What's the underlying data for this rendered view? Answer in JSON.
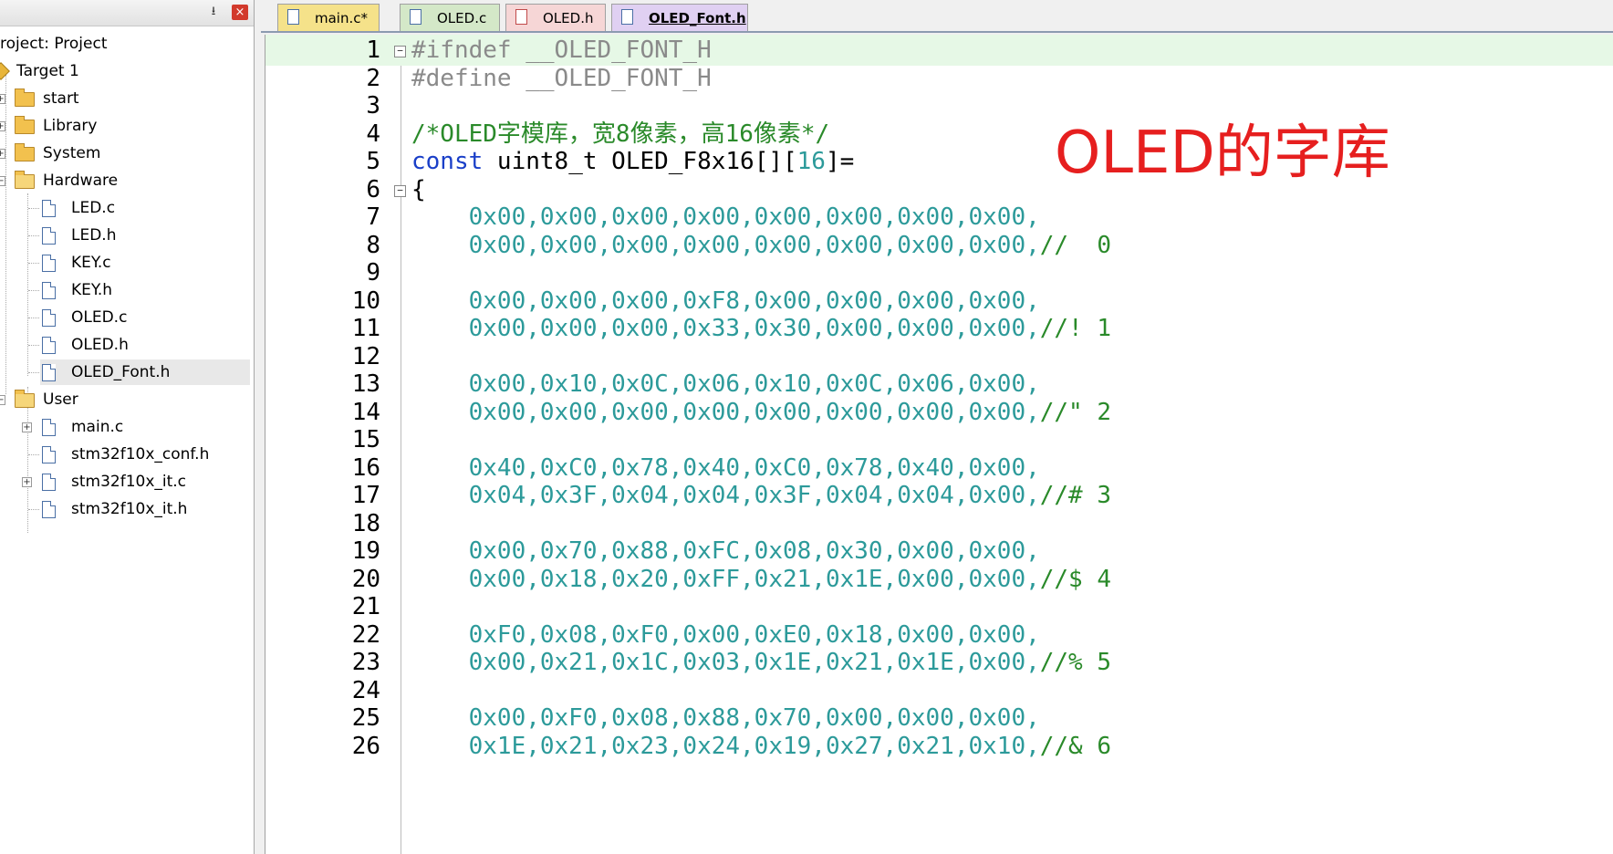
{
  "panel": {
    "pin": " ↓",
    "close": "×",
    "tree": [
      {
        "label": "roject: Project"
      },
      {
        "label": "Target 1"
      },
      {
        "label": "start"
      },
      {
        "label": "Library"
      },
      {
        "label": "System"
      },
      {
        "label": "Hardware"
      },
      {
        "label": "LED.c"
      },
      {
        "label": "LED.h"
      },
      {
        "label": "KEY.c"
      },
      {
        "label": "KEY.h"
      },
      {
        "label": "OLED.c"
      },
      {
        "label": "OLED.h"
      },
      {
        "label": "OLED_Font.h"
      },
      {
        "label": "User"
      },
      {
        "label": "main.c"
      },
      {
        "label": "stm32f10x_conf.h"
      },
      {
        "label": "stm32f10x_it.c"
      },
      {
        "label": "stm32f10x_it.h"
      }
    ]
  },
  "tabs": [
    {
      "label": "main.c*"
    },
    {
      "label": "OLED.c"
    },
    {
      "label": "OLED.h"
    },
    {
      "label": "OLED_Font.h"
    }
  ],
  "editor": {
    "lines": [
      {
        "n": "1",
        "segments": [
          {
            "t": "#ifndef __OLED_FONT_H",
            "c": "pre"
          }
        ]
      },
      {
        "n": "2",
        "segments": [
          {
            "t": "#define __OLED_FONT_H",
            "c": "pre"
          }
        ]
      },
      {
        "n": "3",
        "segments": []
      },
      {
        "n": "4",
        "segments": [
          {
            "t": "/*OLED字模库，宽8像素，高16像素*/",
            "c": "com"
          }
        ]
      },
      {
        "n": "5",
        "segments": [
          {
            "t": "const",
            "c": "kw"
          },
          {
            "t": " uint8_t OLED_F8x16[][",
            "c": "plain"
          },
          {
            "t": "16",
            "c": "num"
          },
          {
            "t": "]=",
            "c": "plain"
          }
        ]
      },
      {
        "n": "6",
        "segments": [
          {
            "t": "{",
            "c": "plain"
          }
        ]
      },
      {
        "n": "7",
        "segments": [
          {
            "t": "    0x00,0x00,0x00,0x00,0x00,0x00,0x00,0x00,",
            "c": "num"
          }
        ]
      },
      {
        "n": "8",
        "segments": [
          {
            "t": "    0x00,0x00,0x00,0x00,0x00,0x00,0x00,0x00,",
            "c": "num"
          },
          {
            "t": "//  0",
            "c": "com"
          }
        ]
      },
      {
        "n": "9",
        "segments": []
      },
      {
        "n": "10",
        "segments": [
          {
            "t": "    0x00,0x00,0x00,0xF8,0x00,0x00,0x00,0x00,",
            "c": "num"
          }
        ]
      },
      {
        "n": "11",
        "segments": [
          {
            "t": "    0x00,0x00,0x00,0x33,0x30,0x00,0x00,0x00,",
            "c": "num"
          },
          {
            "t": "//! 1",
            "c": "com"
          }
        ]
      },
      {
        "n": "12",
        "segments": []
      },
      {
        "n": "13",
        "segments": [
          {
            "t": "    0x00,0x10,0x0C,0x06,0x10,0x0C,0x06,0x00,",
            "c": "num"
          }
        ]
      },
      {
        "n": "14",
        "segments": [
          {
            "t": "    0x00,0x00,0x00,0x00,0x00,0x00,0x00,0x00,",
            "c": "num"
          },
          {
            "t": "//\" 2",
            "c": "com"
          }
        ]
      },
      {
        "n": "15",
        "segments": []
      },
      {
        "n": "16",
        "segments": [
          {
            "t": "    0x40,0xC0,0x78,0x40,0xC0,0x78,0x40,0x00,",
            "c": "num"
          }
        ]
      },
      {
        "n": "17",
        "segments": [
          {
            "t": "    0x04,0x3F,0x04,0x04,0x3F,0x04,0x04,0x00,",
            "c": "num"
          },
          {
            "t": "//# 3",
            "c": "com"
          }
        ]
      },
      {
        "n": "18",
        "segments": []
      },
      {
        "n": "19",
        "segments": [
          {
            "t": "    0x00,0x70,0x88,0xFC,0x08,0x30,0x00,0x00,",
            "c": "num"
          }
        ]
      },
      {
        "n": "20",
        "segments": [
          {
            "t": "    0x00,0x18,0x20,0xFF,0x21,0x1E,0x00,0x00,",
            "c": "num"
          },
          {
            "t": "//$ 4",
            "c": "com"
          }
        ]
      },
      {
        "n": "21",
        "segments": []
      },
      {
        "n": "22",
        "segments": [
          {
            "t": "    0xF0,0x08,0xF0,0x00,0xE0,0x18,0x00,0x00,",
            "c": "num"
          }
        ]
      },
      {
        "n": "23",
        "segments": [
          {
            "t": "    0x00,0x21,0x1C,0x03,0x1E,0x21,0x1E,0x00,",
            "c": "num"
          },
          {
            "t": "//% 5",
            "c": "com"
          }
        ]
      },
      {
        "n": "24",
        "segments": []
      },
      {
        "n": "25",
        "segments": [
          {
            "t": "    0x00,0xF0,0x08,0x88,0x70,0x00,0x00,0x00,",
            "c": "num"
          }
        ]
      },
      {
        "n": "26",
        "segments": [
          {
            "t": "    0x1E,0x21,0x23,0x24,0x19,0x27,0x21,0x10,",
            "c": "num"
          },
          {
            "t": "//& 6",
            "c": "com"
          }
        ]
      }
    ]
  },
  "overlay": {
    "text": "OLED的字库"
  }
}
